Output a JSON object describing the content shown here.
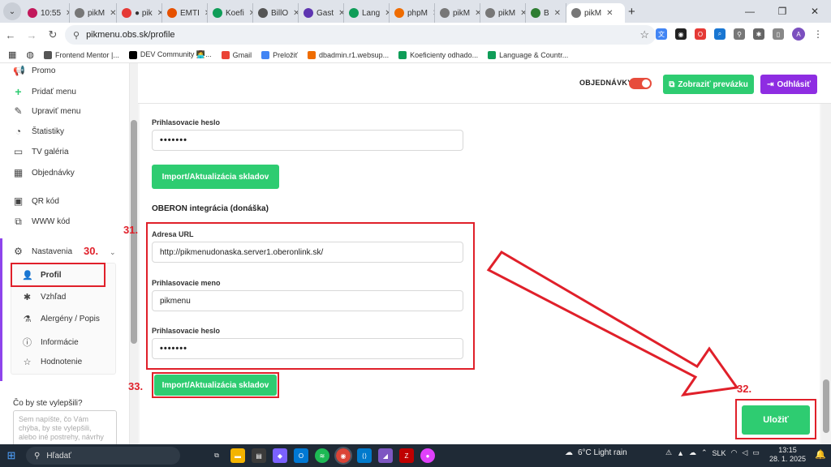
{
  "browser": {
    "tabs": [
      {
        "label": "10:55",
        "color": "#c2185b"
      },
      {
        "label": "pikM",
        "color": "#777777"
      },
      {
        "label": "● pik",
        "color": "#e53935"
      },
      {
        "label": "EMTI",
        "color": "#e65100"
      },
      {
        "label": "Koefi",
        "color": "#0f9d58"
      },
      {
        "label": "BillO",
        "color": "#555555"
      },
      {
        "label": "Gast",
        "color": "#5e35b1"
      },
      {
        "label": "Lang",
        "color": "#0f9d58"
      },
      {
        "label": "phpM",
        "color": "#ef6c00"
      },
      {
        "label": "pikM",
        "color": "#777777"
      },
      {
        "label": "pikM",
        "color": "#777777"
      },
      {
        "label": "B",
        "color": "#2e7d32"
      },
      {
        "label": "pikM",
        "color": "#777777"
      }
    ],
    "url": "pikmenu.obs.sk/profile",
    "avatar_letter": "A",
    "bookmarks": [
      {
        "label": "Frontend Mentor |...",
        "color": "#555555"
      },
      {
        "label": "DEV Community 👩‍💻...",
        "color": "#000000"
      },
      {
        "label": "Gmail",
        "color": "#ea4335"
      },
      {
        "label": "Preložiť",
        "color": "#4285f4"
      },
      {
        "label": "dbadmin.r1.websup...",
        "color": "#ef6c00"
      },
      {
        "label": "Koeficienty odhado...",
        "color": "#0f9d58"
      },
      {
        "label": "Language & Countr...",
        "color": "#0f9d58"
      }
    ]
  },
  "sidebar": {
    "items": [
      {
        "label": "Promo",
        "icon": "megaphone-icon",
        "glyph": "📢"
      },
      {
        "label": "Pridať menu",
        "icon": "plus-icon",
        "glyph": "+"
      },
      {
        "label": "Upraviť menu",
        "icon": "pencil-icon",
        "glyph": "✎"
      },
      {
        "label": "Štatistiky",
        "icon": "chart-icon",
        "glyph": "◔"
      },
      {
        "label": "TV galéria",
        "icon": "tv-icon",
        "glyph": "▭"
      },
      {
        "label": "Objednávky",
        "icon": "table-icon",
        "glyph": "▦"
      },
      {
        "label": "QR kód",
        "icon": "qr-icon",
        "glyph": "▣"
      },
      {
        "label": "WWW kód",
        "icon": "code-icon",
        "glyph": "⧉"
      },
      {
        "label": "Nastavenia",
        "icon": "gear-icon",
        "glyph": "⚙"
      }
    ],
    "submenu": [
      {
        "label": "Profil",
        "icon": "user-icon",
        "glyph": "👤"
      },
      {
        "label": "Vzhľad",
        "icon": "puzzle-icon",
        "glyph": "✱"
      },
      {
        "label": "Alergény / Popis",
        "icon": "flask-icon",
        "glyph": "⚗"
      },
      {
        "label": "Informácie",
        "icon": "info-icon",
        "glyph": "ⓘ"
      },
      {
        "label": "Hodnotenie",
        "icon": "star-icon",
        "glyph": "☆"
      }
    ],
    "feedback_question": "Čo by ste vylepšili?",
    "feedback_placeholder": "Sem napíšte, čo Vám chýba, by ste vylepšili, alebo iné postrehy, návrhy"
  },
  "topbar": {
    "orders_label": "OBJEDNÁVKY",
    "orders_toggle_on": true,
    "show_store_label": "Zobraziť prevázku",
    "logout_label": "Odhlásiť"
  },
  "form": {
    "top_password_label": "Prihlasovacie heslo",
    "top_password_value": "•••••••",
    "top_import_label": "Import/Aktualizácia skladov",
    "oberon_title": "OBERON integrácia (donáška)",
    "url_label": "Adresa URL",
    "url_value": "http://pikmenudonaska.server1.oberonlink.sk/",
    "username_label": "Prihlasovacie meno",
    "username_value": "pikmenu",
    "password_label": "Prihlasovacie heslo",
    "password_value": "•••••••",
    "import_label": "Import/Aktualizácia skladov",
    "save_label": "Uložiť"
  },
  "annotations": {
    "n30": "30.",
    "n31": "31.",
    "n32": "32.",
    "n33": "33.",
    "color": "#e0202a"
  },
  "taskbar": {
    "search_placeholder": "Hľadať",
    "weather": "6°C  Light rain",
    "language": "SLK",
    "time": "13:15",
    "date": "28. 1. 2025"
  }
}
